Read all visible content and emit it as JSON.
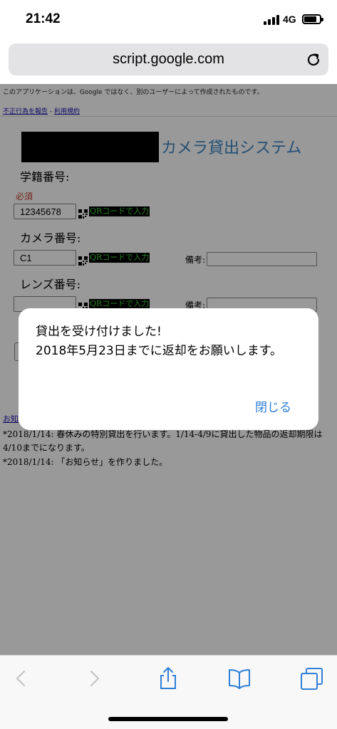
{
  "status_bar": {
    "time": "21:42",
    "network": "4G",
    "icons": [
      "signal-icon",
      "battery-icon"
    ]
  },
  "browser": {
    "url": "script.google.com",
    "reload_icon": "reload-icon"
  },
  "page": {
    "google_notice": "このアプリケーションは、Google ではなく、別のユーザーによって作成されたものです。",
    "report_abuse_link": "不正行為を報告",
    "link_separator": " - ",
    "terms_link": "利用規約",
    "app_title": "カメラ貸出システム",
    "student_id_label": "学籍番号:",
    "required_label": "必須",
    "student_id_value": "12345678",
    "qr_input_label": "QRコードで入力",
    "camera_label": "カメラ番号:",
    "camera_value": "C1",
    "remark_label": "備考:",
    "lens_label": "レンズ番号:",
    "lens_value": "",
    "partial_link": "お知",
    "news": [
      "*2018/1/14: 春休みの特別貸出を行います。1/14-4/9に貸出した物品の返却期限は4/10までになります。",
      "*2018/1/14: 「お知らせ」を作りました。"
    ]
  },
  "alert": {
    "message": "貸出を受け付けました!\n2018年5月23日までに返却をお願いします。",
    "close_label": "閉じる"
  },
  "toolbar": {
    "items": [
      "back-icon",
      "forward-icon",
      "share-icon",
      "bookmarks-icon",
      "tabs-icon"
    ]
  },
  "colors": {
    "title_blue": "#3d86c4",
    "qr_button_text": "#3ed43e",
    "required_red": "#c0392b",
    "ios_blue": "#2f7fd8"
  }
}
